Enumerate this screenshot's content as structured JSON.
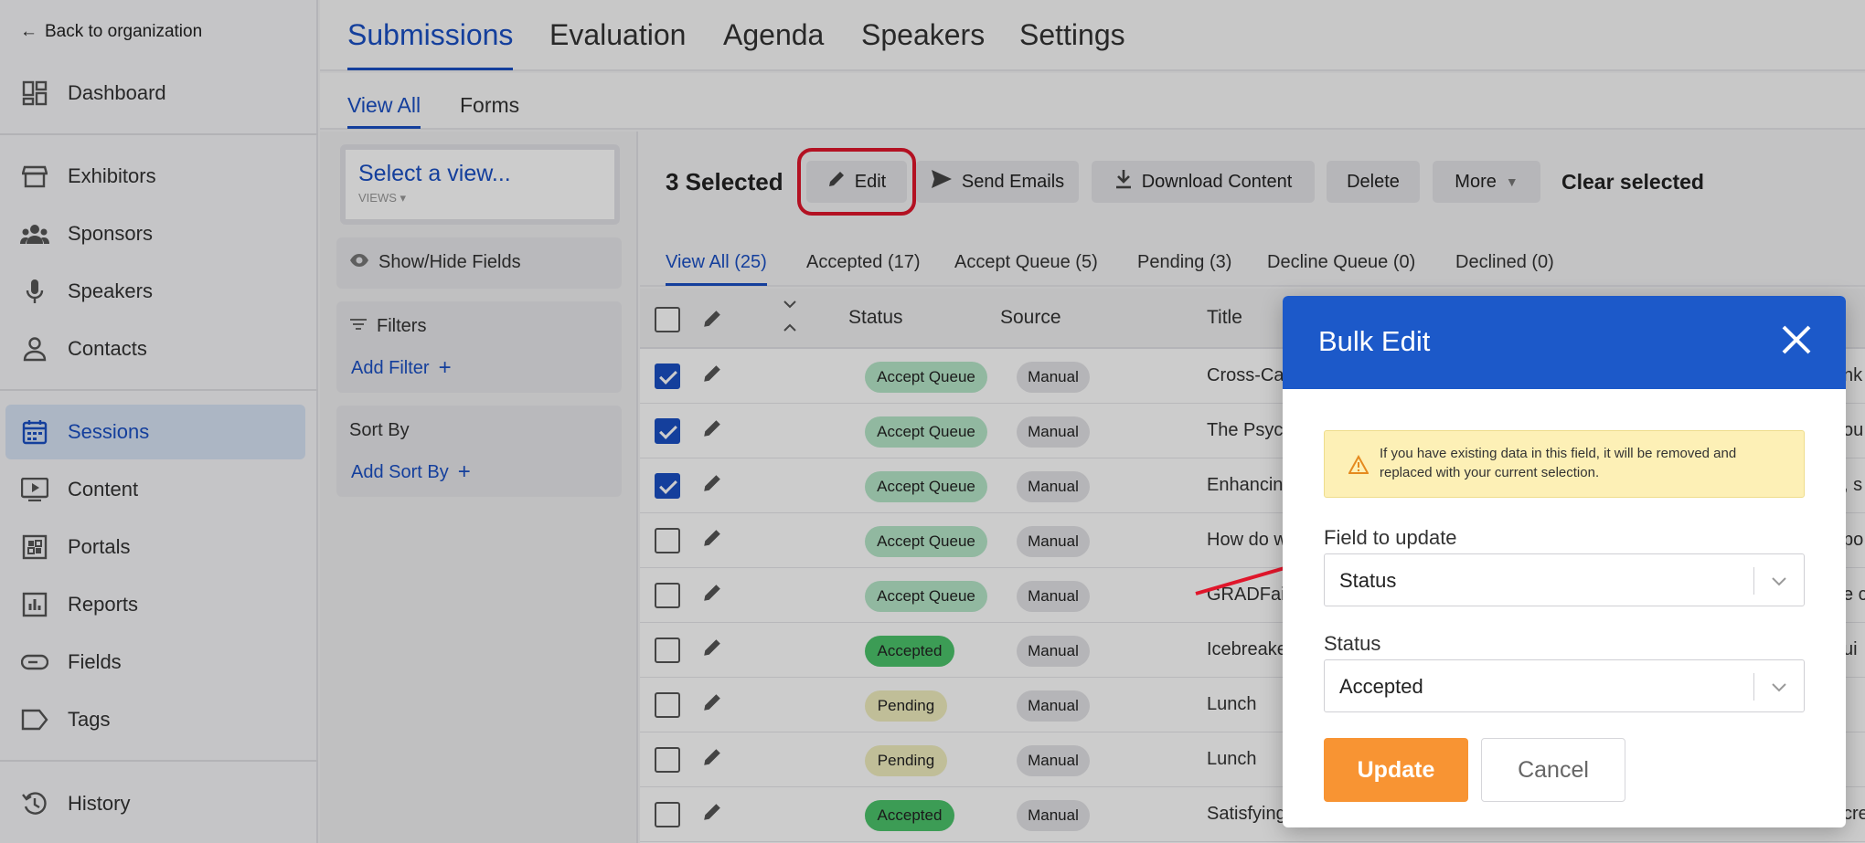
{
  "sidebar": {
    "back_label": "Back to organization",
    "items": [
      {
        "label": "Dashboard",
        "icon": "dashboard-icon"
      },
      {
        "label": "Exhibitors",
        "icon": "store-icon"
      },
      {
        "label": "Sponsors",
        "icon": "people-icon"
      },
      {
        "label": "Speakers",
        "icon": "microphone-icon"
      },
      {
        "label": "Contacts",
        "icon": "person-icon"
      },
      {
        "label": "Sessions",
        "icon": "calendar-icon",
        "active": true
      },
      {
        "label": "Content",
        "icon": "play-icon"
      },
      {
        "label": "Portals",
        "icon": "grid-icon"
      },
      {
        "label": "Reports",
        "icon": "bar-chart-icon"
      },
      {
        "label": "Fields",
        "icon": "field-icon"
      },
      {
        "label": "Tags",
        "icon": "tag-icon"
      },
      {
        "label": "History",
        "icon": "history-icon"
      }
    ]
  },
  "main_tabs": [
    "Submissions",
    "Evaluation",
    "Agenda",
    "Speakers",
    "Settings"
  ],
  "sub_tabs": [
    "View All",
    "Forms"
  ],
  "filter_panel": {
    "view_title": "Select a view...",
    "view_sub": "VIEWS",
    "show_hide": "Show/Hide Fields",
    "filters_label": "Filters",
    "add_filter": "Add Filter",
    "sort_by_label": "Sort By",
    "add_sort_by": "Add Sort By"
  },
  "toolbar": {
    "selected_count": "3 Selected",
    "edit": "Edit",
    "send_emails": "Send Emails",
    "download_content": "Download Content",
    "delete": "Delete",
    "more": "More",
    "clear_selected": "Clear selected"
  },
  "status_tabs": [
    "View All (25)",
    "Accepted (17)",
    "Accept Queue (5)",
    "Pending (3)",
    "Decline Queue (0)",
    "Declined (0)"
  ],
  "table": {
    "headers": {
      "status": "Status",
      "source": "Source",
      "title": "Title"
    },
    "rows": [
      {
        "checked": true,
        "status": "Accept Queue",
        "status_type": "accept-queue",
        "source": "Manual",
        "title": "Cross-Ca",
        "clip": "nk"
      },
      {
        "checked": true,
        "status": "Accept Queue",
        "status_type": "accept-queue",
        "source": "Manual",
        "title": "The Psyc",
        "clip": "ou"
      },
      {
        "checked": true,
        "status": "Accept Queue",
        "status_type": "accept-queue",
        "source": "Manual",
        "title": "Enhancin",
        "clip": ", s"
      },
      {
        "checked": false,
        "status": "Accept Queue",
        "status_type": "accept-queue",
        "source": "Manual",
        "title": "How do w",
        "clip": "po"
      },
      {
        "checked": false,
        "status": "Accept Queue",
        "status_type": "accept-queue",
        "source": "Manual",
        "title": "GRADFai",
        "clip": "e c"
      },
      {
        "checked": false,
        "status": "Accepted",
        "status_type": "accepted",
        "source": "Manual",
        "title": "Icebreake",
        "clip": "ui"
      },
      {
        "checked": false,
        "status": "Pending",
        "status_type": "pending",
        "source": "Manual",
        "title": "Lunch",
        "clip": ""
      },
      {
        "checked": false,
        "status": "Pending",
        "status_type": "pending",
        "source": "Manual",
        "title": "Lunch",
        "clip": ""
      },
      {
        "checked": false,
        "status": "Accepted",
        "status_type": "accepted",
        "source": "Manual",
        "title": "Satisfying",
        "clip": "cre"
      }
    ]
  },
  "modal": {
    "title": "Bulk Edit",
    "warning": "If you have existing data in this field, it will be removed and replaced with your current selection.",
    "field_label": "Field to update",
    "field_value": "Status",
    "status_label": "Status",
    "status_value": "Accepted",
    "update": "Update",
    "cancel": "Cancel"
  },
  "colors": {
    "brand_blue": "#1a4fc4",
    "modal_header": "#1c59c9",
    "update_button": "#f89433",
    "accept_queue_pill": "#b6e7c9",
    "accepted_pill": "#4cc46b",
    "pending_pill": "#f0eebf",
    "warning_bg": "#fdf0b6",
    "highlight_red": "#e0162b"
  }
}
